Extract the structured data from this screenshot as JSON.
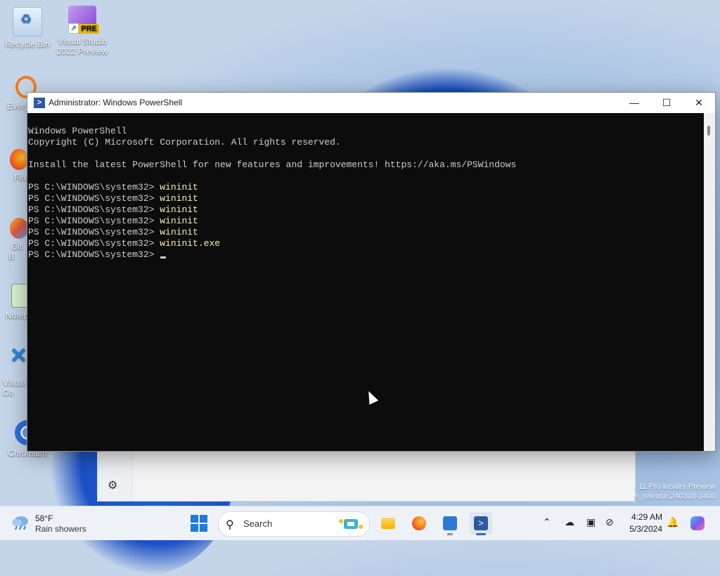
{
  "desktop": {
    "icons": [
      {
        "label": "Recycle Bin"
      },
      {
        "label": "Visual Studio 2022 Preview",
        "badge": "PRE"
      },
      {
        "label": "Every"
      },
      {
        "label": "Fire"
      },
      {
        "label": "Git B"
      },
      {
        "label": "Notep"
      },
      {
        "label": "Visual Co"
      },
      {
        "label": "Chromium"
      }
    ]
  },
  "powershell": {
    "title": "Administrator: Windows PowerShell",
    "controls": {
      "minimize": "—",
      "maximize": "☐",
      "close": "✕"
    },
    "lines": [
      "Windows PowerShell",
      "Copyright (C) Microsoft Corporation. All rights reserved.",
      "",
      "Install the latest PowerShell for new features and improvements! https://aka.ms/PSWindows",
      ""
    ],
    "prompt": "PS C:\\WINDOWS\\system32> ",
    "commands": [
      "wininit",
      "wininit",
      "wininit",
      "wininit",
      "wininit",
      "wininit.exe"
    ]
  },
  "watermark": {
    "line1": "11 Pro Insider Preview",
    "line2": "e_release.240308-1400"
  },
  "taskbar": {
    "weather": {
      "temp": "58°F",
      "condition": "Rain showers"
    },
    "search_placeholder": "Search",
    "clock": {
      "time": "4:29 AM",
      "date": "5/3/2024"
    }
  },
  "colors": {
    "accent": "#1f6fd6",
    "terminal_bg": "#0c0c0c",
    "terminal_fg": "#cccccc",
    "command_fg": "#f9f1a5"
  }
}
